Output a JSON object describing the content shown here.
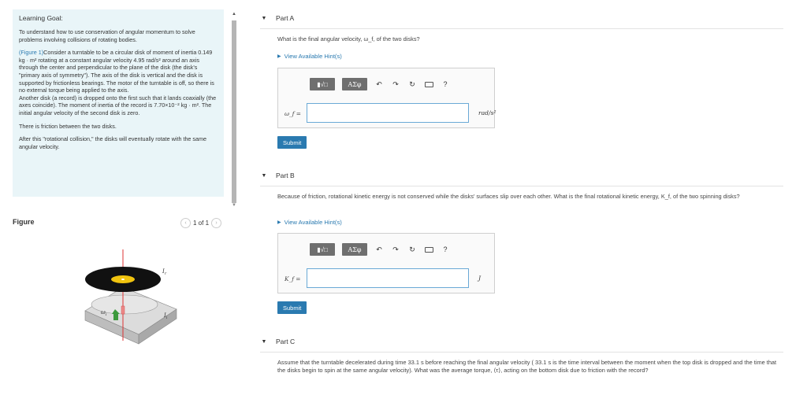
{
  "learning_goal": {
    "title": "Learning Goal:",
    "intro": "To understand how to use conservation of angular momentum to solve problems involving collisions of rotating bodies.",
    "figure_link": "(Figure 1)",
    "p1": "Consider a turntable to be a circular disk of moment of inertia 0.149 kg · m² rotating at a constant angular velocity 4.95 rad/s² around an axis through the center and perpendicular to the plane of the disk (the disk's \"primary axis of symmetry\"). The axis of the disk is vertical and the disk is supported by frictionless bearings. The motor of the turntable is off, so there is no external torque being applied to the axis.",
    "p2": "Another disk (a record) is dropped onto the first such that it lands coaxially (the axes coincide). The moment of inertia of the record is 7.70×10⁻² kg · m². The initial angular velocity of the second disk is zero.",
    "p3": "There is friction between the two disks.",
    "p4": "After this \"rotational collision,\" the disks will eventually rotate with the same angular velocity."
  },
  "figure": {
    "label": "Figure",
    "pager": "1 of 1",
    "labels": {
      "if": "I_f",
      "omega_i": "ω_i",
      "ii": "I_i"
    }
  },
  "parts": {
    "a": {
      "title": "Part A",
      "question": "What is the final angular velocity, ω_f, of the two disks?",
      "hint": "View Available Hint(s)",
      "answer_label": "ω_f =",
      "answer_value": "",
      "unit": "rad/s²",
      "submit": "Submit"
    },
    "b": {
      "title": "Part B",
      "question": "Because of friction, rotational kinetic energy is not conserved while the disks' surfaces slip over each other. What is the final rotational kinetic energy, K_f, of the two spinning disks?",
      "hint": "View Available Hint(s)",
      "answer_label": "K_f =",
      "answer_value": "",
      "unit": "J",
      "submit": "Submit"
    },
    "c": {
      "title": "Part C",
      "question": "Assume that the turntable decelerated during time 33.1 s before reaching the final angular velocity ( 33.1 s is the time interval between the moment when the top disk is dropped and the time that the disks begin to spin at the same angular velocity). What was the average torque, ⟨τ⟩, acting on the bottom disk due to friction with the record?"
    }
  },
  "toolbar": {
    "templates_icon": "templates-icon",
    "greek_label": "ΑΣφ",
    "undo": "↶",
    "redo": "↷",
    "reset": "↻",
    "help": "?"
  }
}
